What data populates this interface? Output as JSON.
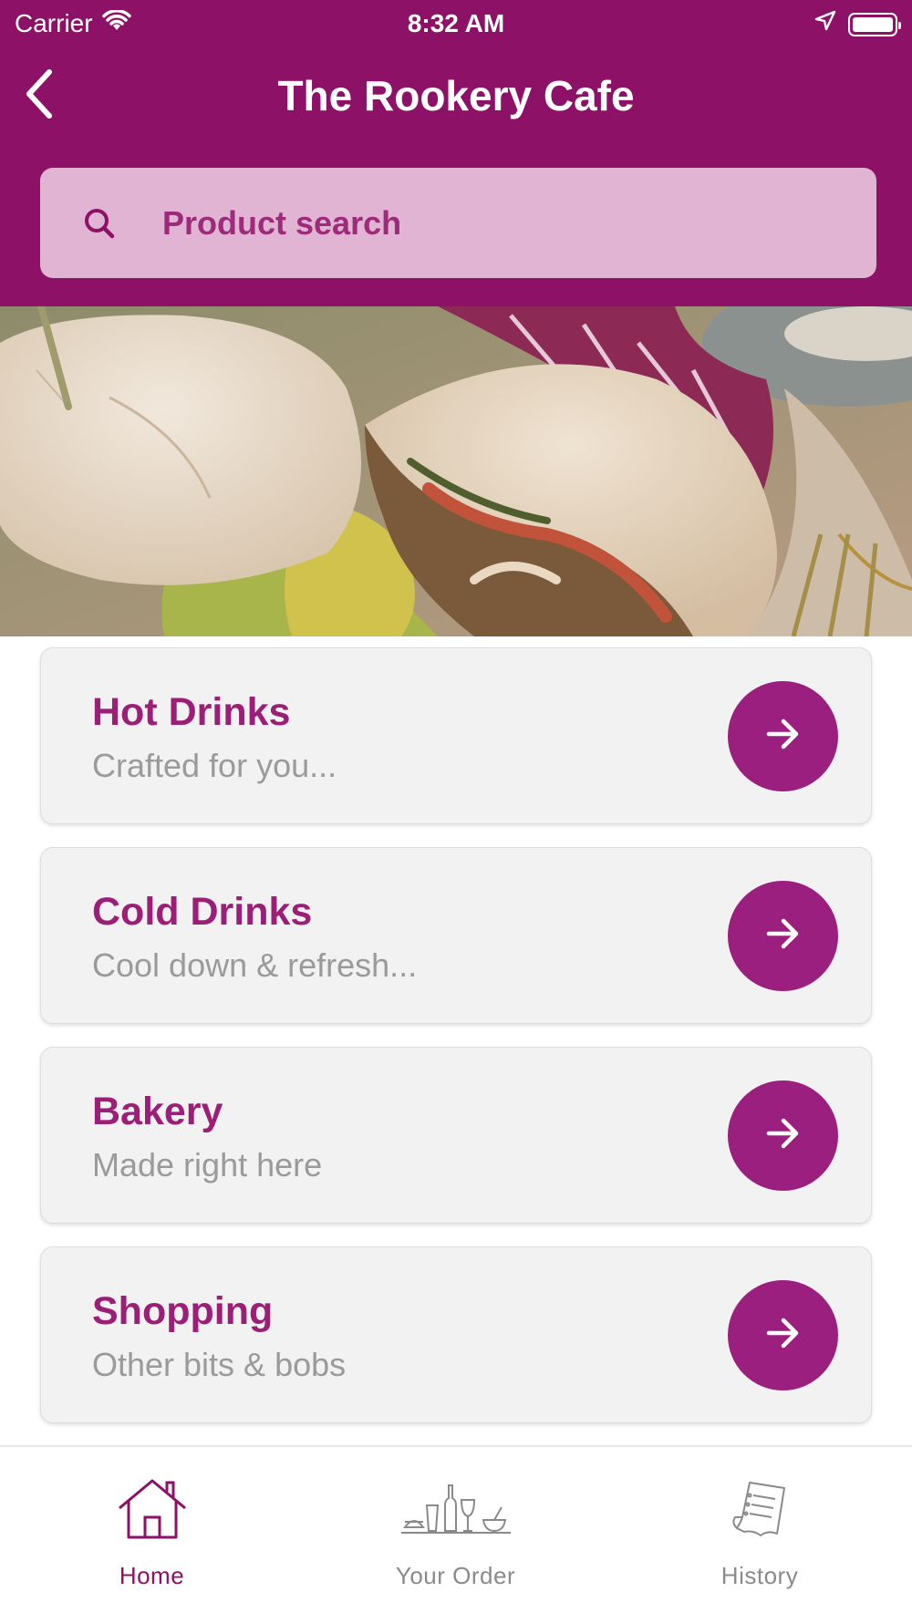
{
  "status_bar": {
    "carrier": "Carrier",
    "time": "8:32 AM"
  },
  "nav": {
    "title": "The Rookery Cafe",
    "back_icon": "chevron-left-icon"
  },
  "search": {
    "placeholder": "Product search",
    "icon": "search-icon"
  },
  "hero": {
    "image": "sandwich-photo"
  },
  "categories": [
    {
      "title": "Hot Drinks",
      "subtitle": "Crafted for you..."
    },
    {
      "title": "Cold Drinks",
      "subtitle": "Cool down & refresh..."
    },
    {
      "title": "Bakery",
      "subtitle": "Made right here"
    },
    {
      "title": "Shopping",
      "subtitle": "Other bits & bobs"
    }
  ],
  "tabs": [
    {
      "label": "Home",
      "icon": "home-icon",
      "active": true
    },
    {
      "label": "Your Order",
      "icon": "food-drinks-icon",
      "active": false
    },
    {
      "label": "History",
      "icon": "receipt-icon",
      "active": false
    }
  ],
  "colors": {
    "brand": "#8e1168",
    "accent": "#9b1f7e",
    "search_bg": "#e0b4d2",
    "card_bg": "#f2f2f2",
    "subtitle": "#9a9a9a"
  }
}
